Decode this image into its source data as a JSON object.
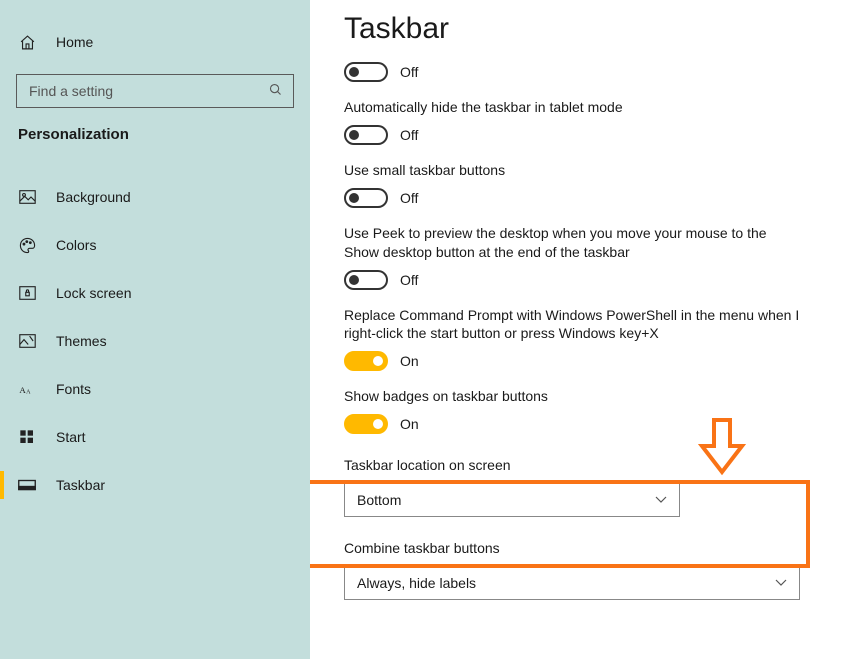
{
  "sidebar": {
    "home_label": "Home",
    "search_placeholder": "Find a setting",
    "category_title": "Personalization",
    "items": [
      {
        "label": "Background"
      },
      {
        "label": "Colors"
      },
      {
        "label": "Lock screen"
      },
      {
        "label": "Themes"
      },
      {
        "label": "Fonts"
      },
      {
        "label": "Start"
      },
      {
        "label": "Taskbar"
      }
    ]
  },
  "page": {
    "title": "Taskbar",
    "toggles": [
      {
        "label_before": "",
        "state": "Off",
        "on": false
      },
      {
        "label": "Automatically hide the taskbar in tablet mode",
        "state": "Off",
        "on": false
      },
      {
        "label": "Use small taskbar buttons",
        "state": "Off",
        "on": false
      },
      {
        "label": "Use Peek to preview the desktop when you move your mouse to the Show desktop button at the end of the taskbar",
        "state": "Off",
        "on": false
      },
      {
        "label": "Replace Command Prompt with Windows PowerShell in the menu when I right-click the start button or press Windows key+X",
        "state": "On",
        "on": true
      },
      {
        "label": "Show badges on taskbar buttons",
        "state": "On",
        "on": true
      }
    ],
    "location": {
      "label": "Taskbar location on screen",
      "value": "Bottom"
    },
    "combine": {
      "label": "Combine taskbar buttons",
      "value": "Always, hide labels"
    }
  }
}
